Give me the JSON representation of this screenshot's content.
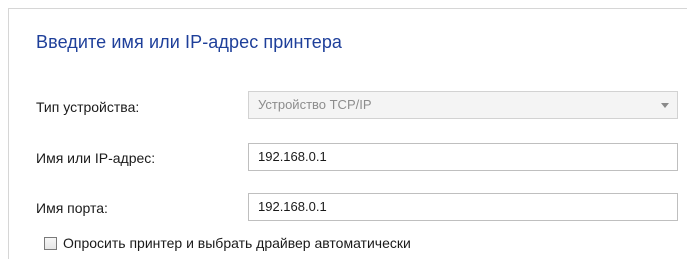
{
  "header": {
    "title": "Введите имя или IP-адрес принтера"
  },
  "form": {
    "device_type": {
      "label": "Тип устройства:",
      "value": "Устройство TCP/IP",
      "disabled": true
    },
    "host": {
      "label": "Имя или IP-адрес:",
      "value": "192.168.0.1"
    },
    "port": {
      "label": "Имя порта:",
      "value": "192.168.0.1"
    },
    "auto_query": {
      "label": "Опросить принтер и выбрать драйвер автоматически",
      "checked": false
    }
  },
  "icons": {
    "dropdown": "chevron-down-icon"
  },
  "colors": {
    "title": "#1e3f9a",
    "border": "#bfbfbf",
    "disabled_bg": "#f4f4f4",
    "disabled_text": "#8d8d8d"
  }
}
